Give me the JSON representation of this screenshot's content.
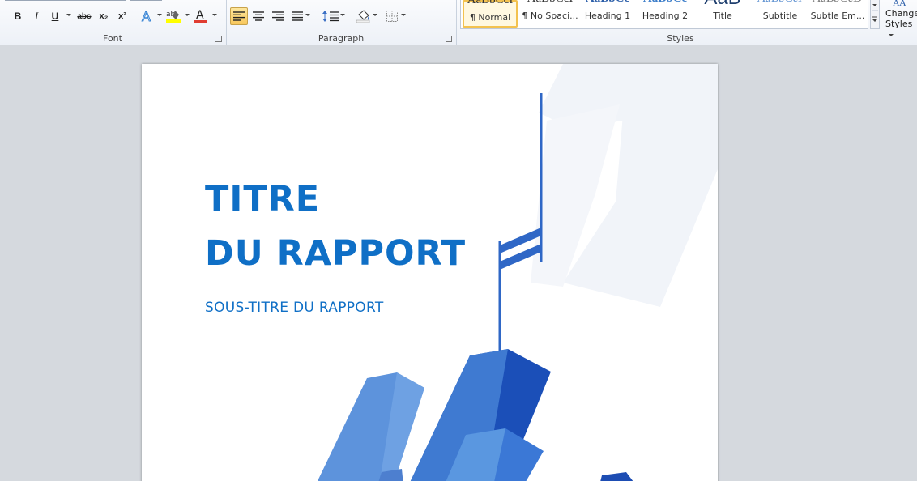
{
  "ribbon": {
    "font_group": {
      "label": "Font",
      "buttons": {
        "bold": "B",
        "italic": "I",
        "underline": "U",
        "strikethrough": "abc",
        "subscript": "x₂",
        "superscript": "x²",
        "highlight_label": "ab"
      },
      "icons": [
        "text-effects-icon",
        "highlight-icon",
        "font-color-icon"
      ],
      "colors": {
        "highlight": "#ffff00",
        "font_color": "#e03c31"
      }
    },
    "paragraph_group": {
      "label": "Paragraph",
      "icons": [
        "align-left-icon",
        "align-center-icon",
        "align-right-icon",
        "justify-icon",
        "line-spacing-icon",
        "shading-icon",
        "borders-icon"
      ]
    },
    "styles_group": {
      "label": "Styles",
      "tiles": [
        {
          "name": "¶ Normal",
          "sample": "AaBbCcI"
        },
        {
          "name": "¶ No Spaci...",
          "sample": "AaBbCcI"
        },
        {
          "name": "Heading 1",
          "sample": "AaBbCc"
        },
        {
          "name": "Heading 2",
          "sample": "AaBbCc"
        },
        {
          "name": "Title",
          "sample": "AaB"
        },
        {
          "name": "Subtitle",
          "sample": "AaBbCcI"
        },
        {
          "name": "Subtle Em...",
          "sample": "AaBbCcD"
        }
      ],
      "change_styles_label_1": "Change",
      "change_styles_label_2": "Styles"
    }
  },
  "document": {
    "title_line_1": "TITRE",
    "title_line_2": "DU RAPPORT",
    "subtitle": "SOUS-TITRE DU RAPPORT",
    "accent_color": "#0f6fc6"
  }
}
